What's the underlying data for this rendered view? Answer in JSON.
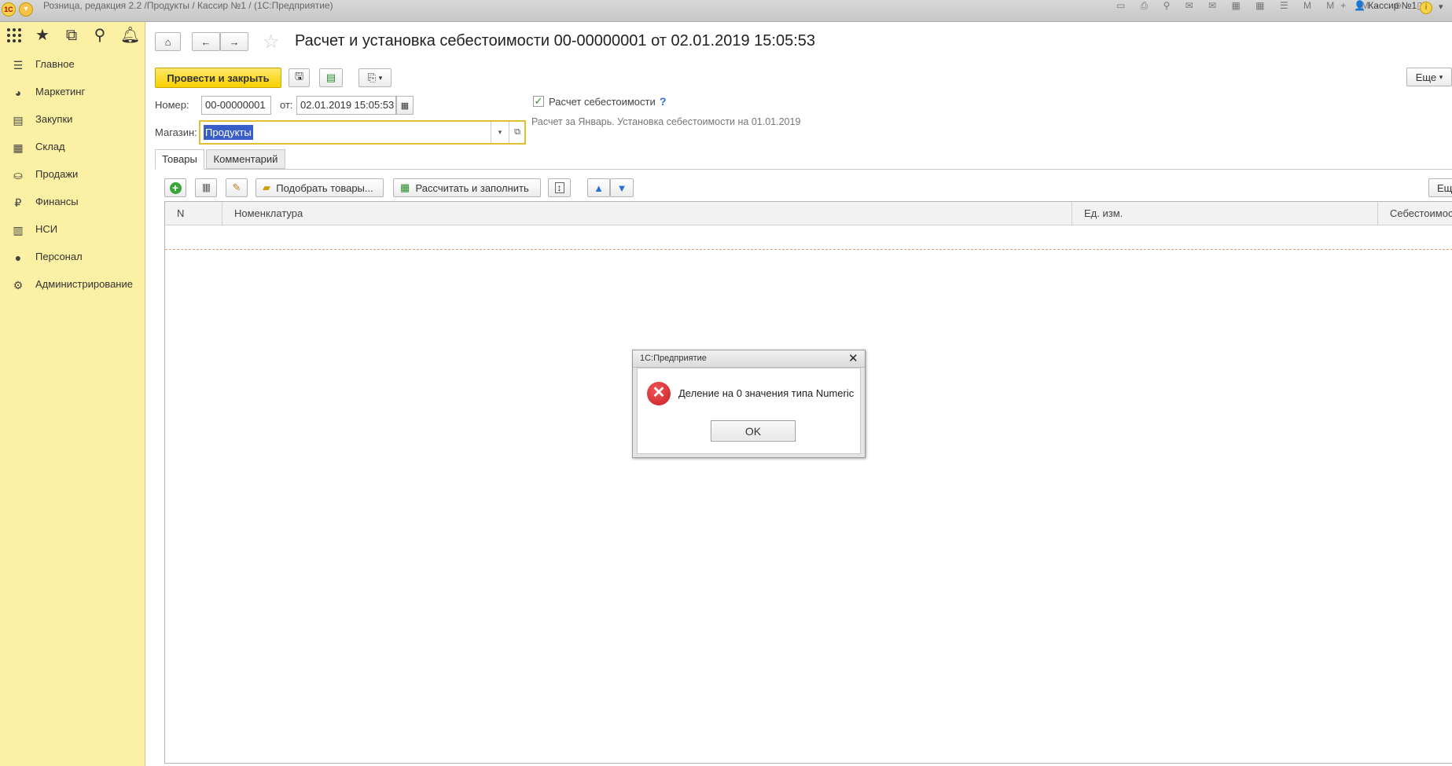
{
  "window": {
    "logo": "1C",
    "title": "Розница, редакция 2.2 /Продукты / Кассир №1 /  (1С:Предприятие)",
    "user": "Кассир №1"
  },
  "sidebar": {
    "items": [
      {
        "label": "Главное",
        "icon": "list-icon"
      },
      {
        "label": "Маркетинг",
        "icon": "pie-chart-icon"
      },
      {
        "label": "Закупки",
        "icon": "cart-icon"
      },
      {
        "label": "Склад",
        "icon": "grid-icon"
      },
      {
        "label": "Продажи",
        "icon": "basket-icon"
      },
      {
        "label": "Финансы",
        "icon": "ruble-icon"
      },
      {
        "label": "НСИ",
        "icon": "books-icon"
      },
      {
        "label": "Персонал",
        "icon": "person-icon"
      },
      {
        "label": "Администрирование",
        "icon": "gear-icon"
      }
    ]
  },
  "form": {
    "title": "Расчет и установка себестоимости 00-00000001 от 02.01.2019 15:05:53",
    "post_close_label": "Провести и закрыть",
    "more_label": "Еще",
    "number_label": "Номер:",
    "number_value": "00-00000001",
    "date_label": "от:",
    "date_value": "02.01.2019 15:05:53",
    "store_label": "Магазин:",
    "store_value": "Продукты",
    "cost_checkbox_label": "Расчет себестоимости",
    "cost_checked": true,
    "help_mark": "?",
    "cost_description": "Расчет за Январь. Установка себестоимости на 01.01.2019"
  },
  "tabs": [
    {
      "label": "Товары",
      "active": true
    },
    {
      "label": "Комментарий",
      "active": false
    }
  ],
  "table_toolbar": {
    "pick_goods_label": "Подобрать товары...",
    "calc_fill_label": "Рассчитать и заполнить",
    "more_label": "Еще"
  },
  "table": {
    "columns": [
      "N",
      "Номенклатура",
      "Ед. изм.",
      "Себестоимость"
    ],
    "rows": []
  },
  "dialog": {
    "title": "1С:Предприятие",
    "message": "Деление на 0 значения типа Numeric",
    "ok_label": "OK"
  },
  "colors": {
    "sidebar_bg": "#fbf0a3",
    "accent_button": "#f6d000",
    "error_icon": "#c81e24",
    "store_field_border": "#e0c030"
  }
}
